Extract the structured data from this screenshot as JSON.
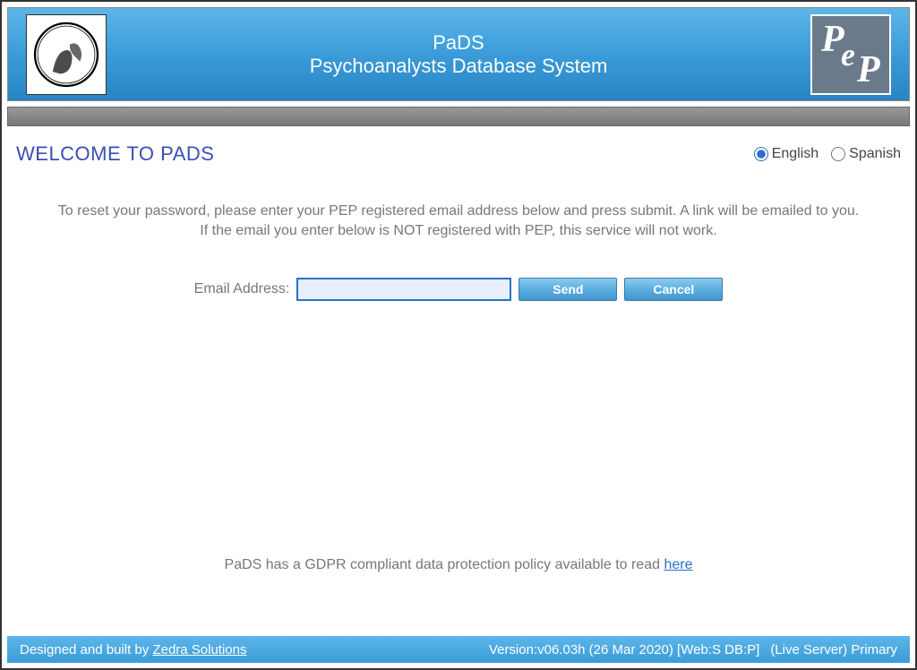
{
  "header": {
    "title_line1": "PaDS",
    "title_line2": "Psychoanalysts Database System"
  },
  "page": {
    "welcome_heading": "WELCOME TO PADS"
  },
  "language": {
    "english_label": "English",
    "spanish_label": "Spanish",
    "selected": "english"
  },
  "instructions": {
    "line1": "To reset your password, please enter your PEP registered email address below and press submit. A link will be emailed to you.",
    "line2": "If the email you enter below is NOT registered with PEP, this service will not work."
  },
  "form": {
    "email_label": "Email Address:",
    "email_value": "",
    "send_label": "Send",
    "cancel_label": "Cancel"
  },
  "gdpr": {
    "text": "PaDS has a GDPR compliant data protection policy available to read ",
    "link_label": "here"
  },
  "footer": {
    "designed_prefix": "Designed and built by ",
    "designed_link": "Zedra Solutions",
    "version": "Version:v06.03h (26 Mar 2020) [Web:S DB:P]",
    "server": "(Live Server) Primary"
  }
}
